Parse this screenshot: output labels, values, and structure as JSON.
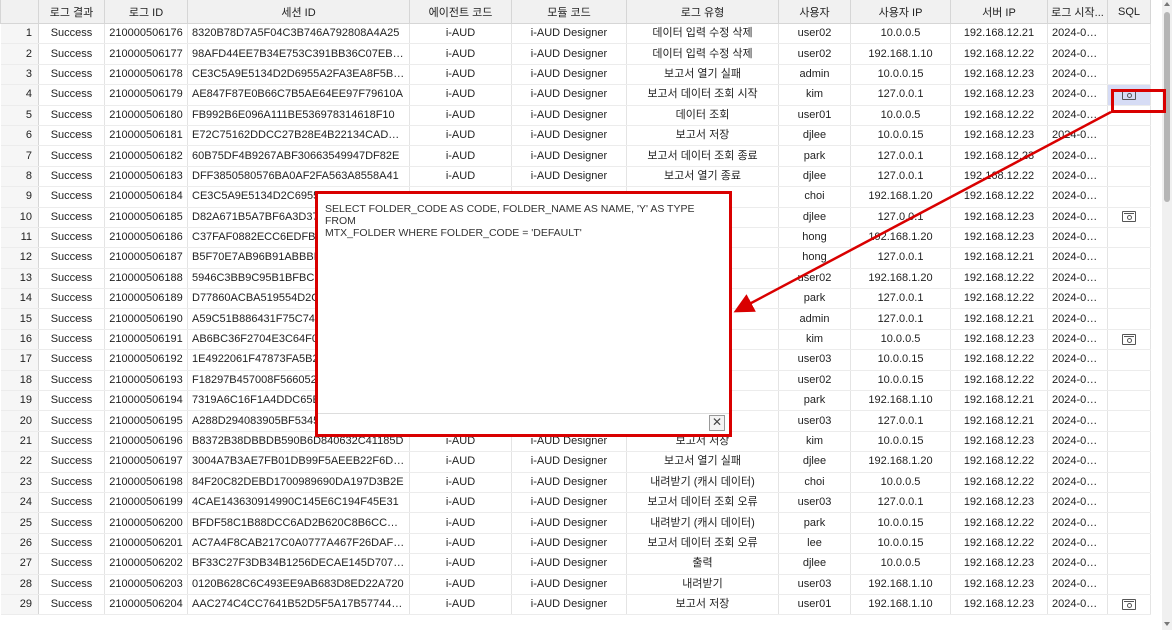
{
  "columns": [
    "",
    "로그 결과",
    "로그 ID",
    "세션 ID",
    "에이전트 코드",
    "모듈 코드",
    "로그 유형",
    "사용자",
    "사용자 IP",
    "서버 IP",
    "로그 시작...",
    "SQL"
  ],
  "rows": [
    {
      "n": "1",
      "result": "Success",
      "log_id": "210000506176",
      "session": "8320B78D7A5F04C3B746A792808A4A25",
      "agent": "i-AUD",
      "module": "i-AUD Designer",
      "type": "데이터 입력 수정 삭제",
      "user": "user02",
      "user_ip": "10.0.0.5",
      "server_ip": "192.168.12.21",
      "start": "2024-04-...",
      "sql": false
    },
    {
      "n": "2",
      "result": "Success",
      "log_id": "210000506177",
      "session": "98AFD44EE7B34E753C391BB36C07EBE4",
      "agent": "i-AUD",
      "module": "i-AUD Designer",
      "type": "데이터 입력 수정 삭제",
      "user": "user02",
      "user_ip": "192.168.1.10",
      "server_ip": "192.168.12.22",
      "start": "2024-04-...",
      "sql": false
    },
    {
      "n": "3",
      "result": "Success",
      "log_id": "210000506178",
      "session": "CE3C5A9E5134D2D6955A2FA3EA8F5BA3",
      "agent": "i-AUD",
      "module": "i-AUD Designer",
      "type": "보고서 열기 실패",
      "user": "admin",
      "user_ip": "10.0.0.15",
      "server_ip": "192.168.12.23",
      "start": "2024-04-...",
      "sql": false
    },
    {
      "n": "4",
      "result": "Success",
      "log_id": "210000506179",
      "session": "AE847F87E0B66C7B5AE64EE97F79610A",
      "agent": "i-AUD",
      "module": "i-AUD Designer",
      "type": "보고서 데이터 조회 시작",
      "user": "kim",
      "user_ip": "127.0.0.1",
      "server_ip": "192.168.12.23",
      "start": "2024-04-...",
      "sql": true,
      "selected": true
    },
    {
      "n": "5",
      "result": "Success",
      "log_id": "210000506180",
      "session": "FB992B6E096A111BE536978314618F10",
      "agent": "i-AUD",
      "module": "i-AUD Designer",
      "type": "데이터 조회",
      "user": "user01",
      "user_ip": "10.0.0.5",
      "server_ip": "192.168.12.22",
      "start": "2024-04-...",
      "sql": false
    },
    {
      "n": "6",
      "result": "Success",
      "log_id": "210000506181",
      "session": "E72C75162DDCC27B28E4B22134CADB80",
      "agent": "i-AUD",
      "module": "i-AUD Designer",
      "type": "보고서 저장",
      "user": "djlee",
      "user_ip": "10.0.0.15",
      "server_ip": "192.168.12.23",
      "start": "2024-04-...",
      "sql": false
    },
    {
      "n": "7",
      "result": "Success",
      "log_id": "210000506182",
      "session": "60B75DF4B9267ABF30663549947DF82E",
      "agent": "i-AUD",
      "module": "i-AUD Designer",
      "type": "보고서 데이터 조회 종료",
      "user": "park",
      "user_ip": "127.0.0.1",
      "server_ip": "192.168.12.23",
      "start": "2024-04-...",
      "sql": false
    },
    {
      "n": "8",
      "result": "Success",
      "log_id": "210000506183",
      "session": "DFF3850580576BA0AF2FA563A8558A41",
      "agent": "i-AUD",
      "module": "i-AUD Designer",
      "type": "보고서 열기 종료",
      "user": "djlee",
      "user_ip": "127.0.0.1",
      "server_ip": "192.168.12.22",
      "start": "2024-04-...",
      "sql": false
    },
    {
      "n": "9",
      "result": "Success",
      "log_id": "210000506184",
      "session": "CE3C5A9E5134D2C6955A",
      "agent": "",
      "module": "",
      "type": "",
      "user": "choi",
      "user_ip": "192.168.1.20",
      "server_ip": "192.168.12.22",
      "start": "2024-04-...",
      "sql": false
    },
    {
      "n": "10",
      "result": "Success",
      "log_id": "210000506185",
      "session": "D82A671B5A7BF6A3D371",
      "agent": "",
      "module": "",
      "type": "",
      "user": "djlee",
      "user_ip": "127.0.0.1",
      "server_ip": "192.168.12.23",
      "start": "2024-04-...",
      "sql": true
    },
    {
      "n": "11",
      "result": "Success",
      "log_id": "210000506186",
      "session": "C37FAF0882ECC6EDFB73",
      "agent": "",
      "module": "",
      "type": "",
      "user": "hong",
      "user_ip": "192.168.1.20",
      "server_ip": "192.168.12.23",
      "start": "2024-04-...",
      "sql": false
    },
    {
      "n": "12",
      "result": "Success",
      "log_id": "210000506187",
      "session": "B5F70E7AB96B91ABBBD7",
      "agent": "",
      "module": "",
      "type": "",
      "user": "hong",
      "user_ip": "127.0.0.1",
      "server_ip": "192.168.12.21",
      "start": "2024-04-...",
      "sql": false
    },
    {
      "n": "13",
      "result": "Success",
      "log_id": "210000506188",
      "session": "5946C3BB9C95B1BFBCF4",
      "agent": "",
      "module": "",
      "type": "",
      "user": "user02",
      "user_ip": "192.168.1.20",
      "server_ip": "192.168.12.22",
      "start": "2024-04-...",
      "sql": false
    },
    {
      "n": "14",
      "result": "Success",
      "log_id": "210000506189",
      "session": "D77860ACBA519554D2C4",
      "agent": "",
      "module": "",
      "type": "",
      "user": "park",
      "user_ip": "127.0.0.1",
      "server_ip": "192.168.12.22",
      "start": "2024-04-...",
      "sql": false
    },
    {
      "n": "15",
      "result": "Success",
      "log_id": "210000506190",
      "session": "A59C51B886431F75C748",
      "agent": "",
      "module": "",
      "type": "",
      "user": "admin",
      "user_ip": "127.0.0.1",
      "server_ip": "192.168.12.21",
      "start": "2024-04-...",
      "sql": false
    },
    {
      "n": "16",
      "result": "Success",
      "log_id": "210000506191",
      "session": "AB6BC36F2704E3C64F0C",
      "agent": "",
      "module": "",
      "type": "",
      "user": "kim",
      "user_ip": "10.0.0.5",
      "server_ip": "192.168.12.23",
      "start": "2024-04-...",
      "sql": true
    },
    {
      "n": "17",
      "result": "Success",
      "log_id": "210000506192",
      "session": "1E4922061F47873FA5B20",
      "agent": "",
      "module": "",
      "type": "",
      "user": "user03",
      "user_ip": "10.0.0.15",
      "server_ip": "192.168.12.22",
      "start": "2024-04-...",
      "sql": false
    },
    {
      "n": "18",
      "result": "Success",
      "log_id": "210000506193",
      "session": "F18297B457008F5660524",
      "agent": "",
      "module": "",
      "type": "",
      "user": "user02",
      "user_ip": "10.0.0.15",
      "server_ip": "192.168.12.22",
      "start": "2024-04-...",
      "sql": false
    },
    {
      "n": "19",
      "result": "Success",
      "log_id": "210000506194",
      "session": "7319A6C16F1A4DDC65E5",
      "agent": "",
      "module": "",
      "type": "",
      "user": "park",
      "user_ip": "192.168.1.10",
      "server_ip": "192.168.12.21",
      "start": "2024-04-...",
      "sql": false
    },
    {
      "n": "20",
      "result": "Success",
      "log_id": "210000506195",
      "session": "A288D294083905BF53458",
      "agent": "",
      "module": "",
      "type": "",
      "user": "user03",
      "user_ip": "127.0.0.1",
      "server_ip": "192.168.12.21",
      "start": "2024-04-...",
      "sql": false
    },
    {
      "n": "21",
      "result": "Success",
      "log_id": "210000506196",
      "session": "B8372B38DBBDB590B6D840632C41185D",
      "agent": "i-AUD",
      "module": "i-AUD Designer",
      "type": "보고서 저장",
      "user": "kim",
      "user_ip": "10.0.0.15",
      "server_ip": "192.168.12.23",
      "start": "2024-04-...",
      "sql": false
    },
    {
      "n": "22",
      "result": "Success",
      "log_id": "210000506197",
      "session": "3004A7B3AE7FB01DB99F5AEEB22F6D14",
      "agent": "i-AUD",
      "module": "i-AUD Designer",
      "type": "보고서 열기 실패",
      "user": "djlee",
      "user_ip": "192.168.1.20",
      "server_ip": "192.168.12.22",
      "start": "2024-04-...",
      "sql": false
    },
    {
      "n": "23",
      "result": "Success",
      "log_id": "210000506198",
      "session": "84F20C82DEBD1700989690DA197D3B2E",
      "agent": "i-AUD",
      "module": "i-AUD Designer",
      "type": "내려받기 (캐시 데이터)",
      "user": "choi",
      "user_ip": "10.0.0.5",
      "server_ip": "192.168.12.22",
      "start": "2024-04-...",
      "sql": false
    },
    {
      "n": "24",
      "result": "Success",
      "log_id": "210000506199",
      "session": "4CAE143630914990C145E6C194F45E31",
      "agent": "i-AUD",
      "module": "i-AUD Designer",
      "type": "보고서 데이터 조회 오류",
      "user": "user03",
      "user_ip": "127.0.0.1",
      "server_ip": "192.168.12.23",
      "start": "2024-04-...",
      "sql": false
    },
    {
      "n": "25",
      "result": "Success",
      "log_id": "210000506200",
      "session": "BFDF58C1B88DCC6AD2B620C8B6CCDAD6",
      "agent": "i-AUD",
      "module": "i-AUD Designer",
      "type": "내려받기 (캐시 데이터)",
      "user": "park",
      "user_ip": "10.0.0.15",
      "server_ip": "192.168.12.22",
      "start": "2024-04-...",
      "sql": false
    },
    {
      "n": "26",
      "result": "Success",
      "log_id": "210000506201",
      "session": "AC7A4F8CAB217C0A0777A467F26DAFCB",
      "agent": "i-AUD",
      "module": "i-AUD Designer",
      "type": "보고서 데이터 조회 오류",
      "user": "lee",
      "user_ip": "10.0.0.15",
      "server_ip": "192.168.12.22",
      "start": "2024-04-...",
      "sql": false
    },
    {
      "n": "27",
      "result": "Success",
      "log_id": "210000506202",
      "session": "BF33C27F3DB34B1256DECAE145D707C8",
      "agent": "i-AUD",
      "module": "i-AUD Designer",
      "type": "출력",
      "user": "djlee",
      "user_ip": "10.0.0.5",
      "server_ip": "192.168.12.23",
      "start": "2024-04-...",
      "sql": false
    },
    {
      "n": "28",
      "result": "Success",
      "log_id": "210000506203",
      "session": "0120B628C6C493EE9AB683D8ED22A720",
      "agent": "i-AUD",
      "module": "i-AUD Designer",
      "type": "내려받기",
      "user": "user03",
      "user_ip": "192.168.1.10",
      "server_ip": "192.168.12.23",
      "start": "2024-04-...",
      "sql": false
    },
    {
      "n": "29",
      "result": "Success",
      "log_id": "210000506204",
      "session": "AAC274C4CC7641B52D5F5A17B57744FC",
      "agent": "i-AUD",
      "module": "i-AUD Designer",
      "type": "보고서 저장",
      "user": "user01",
      "user_ip": "192.168.1.10",
      "server_ip": "192.168.12.23",
      "start": "2024-04-...",
      "sql": true
    }
  ],
  "popup": {
    "sql_text": "SELECT FOLDER_CODE AS CODE, FOLDER_NAME AS NAME, 'Y' AS TYPE FROM\nMTX_FOLDER WHERE FOLDER_CODE = 'DEFAULT'",
    "close_label": "✕"
  },
  "colors": {
    "highlight": "#d90000",
    "selected_cell": "#d6dcf5"
  }
}
